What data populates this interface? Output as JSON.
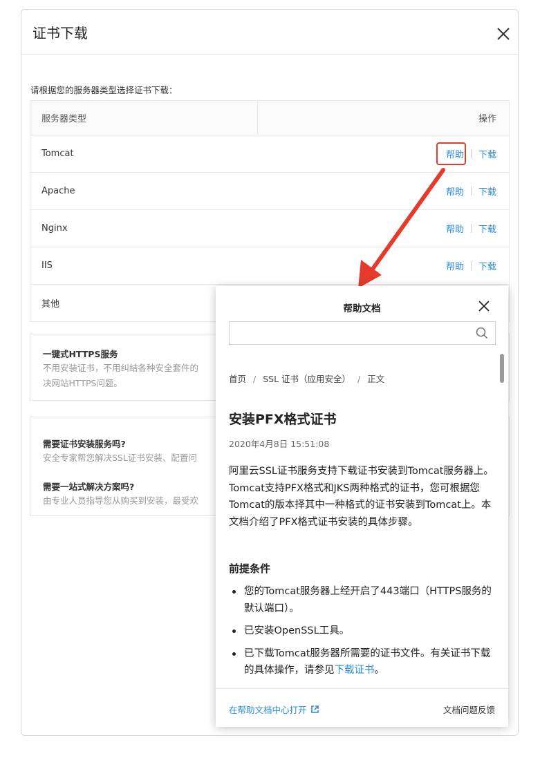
{
  "dialog": {
    "title": "证书下载",
    "instruction": "请根据您的服务器类型选择证书下载：",
    "table": {
      "col_type": "服务器类型",
      "col_action": "操作",
      "rows": [
        {
          "name": "Tomcat",
          "help": "帮助",
          "download": "下载"
        },
        {
          "name": "Apache",
          "help": "帮助",
          "download": "下载"
        },
        {
          "name": "Nginx",
          "help": "帮助",
          "download": "下载"
        },
        {
          "name": "IIS",
          "help": "帮助",
          "download": "下载"
        },
        {
          "name": "其他"
        }
      ]
    },
    "cards": [
      {
        "title": "一键式HTTPS服务",
        "lines": [
          "不用安装证书，不用纠结各种安全套件的",
          "决网站HTTPS问题。"
        ]
      },
      {
        "title": "需要证书安装服务吗?",
        "lines": [
          "安全专家帮您解决SSL证书安装、配置问"
        ]
      },
      {
        "title": "需要一站式解决方案吗?",
        "lines": [
          "由专业人员指导您从购买到安装，最受欢"
        ]
      }
    ]
  },
  "help_panel": {
    "title": "帮助文档",
    "search_placeholder": "",
    "breadcrumb": [
      "首页",
      "SSL 证书（应用安全）",
      "正文"
    ],
    "doc_title": "安装PFX格式证书",
    "doc_date": "2020年4月8日 15:51:08",
    "intro": "阿里云SSL证书服务支持下载证书安装到Tomcat服务器上。Tomcat支持PFX格式和JKS两种格式的证书，您可根据您Tomcat的版本择其中一种格式的证书安装到Tomcat上。本文档介绍了PFX格式证书安装的具体步骤。",
    "prereq_heading": "前提条件",
    "prereqs": [
      "您的Tomcat服务器上经开启了443端口（HTTPS服务的默认端口）。",
      "已安装OpenSSL工具。"
    ],
    "prereq3_text": "已下载Tomcat服务器所需要的证书文件。有关证书下载的具体操作，请参见",
    "prereq3_link": "下载证书",
    "prereq3_end": "。",
    "footer_open": "在帮助文档中心打开",
    "footer_feedback": "文档问题反馈"
  },
  "colors": {
    "link": "#2a8bd6",
    "highlight": "#e43b2d"
  }
}
